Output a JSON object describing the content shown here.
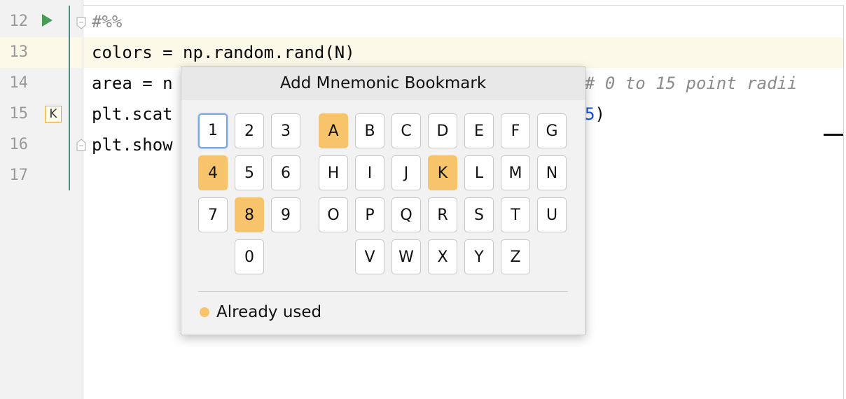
{
  "editor": {
    "lines": [
      {
        "no": "12"
      },
      {
        "no": "13"
      },
      {
        "no": "14"
      },
      {
        "no": "15"
      },
      {
        "no": "16"
      },
      {
        "no": "17"
      }
    ],
    "code": {
      "l12": "#%%",
      "l13": "colors = np.random.rand(N)",
      "l14_pre": "area = n",
      "l14_comment": "# 0 to 15 point radii",
      "l15_pre": "plt.scat",
      "l15_num": "5",
      "l15_post": ")",
      "l16": "plt.show"
    },
    "bookmark_gutter_label": "K",
    "icons": {
      "run": "run-cell-icon",
      "fold_start": "fold-start-icon",
      "fold_end": "fold-end-icon"
    }
  },
  "popup": {
    "title": "Add Mnemonic Bookmark",
    "keys": {
      "k1": "1",
      "k2": "2",
      "k3": "3",
      "k4": "4",
      "k5": "5",
      "k6": "6",
      "k7": "7",
      "k8": "8",
      "k9": "9",
      "k0": "0",
      "A": "A",
      "B": "B",
      "C": "C",
      "D": "D",
      "E": "E",
      "F": "F",
      "G": "G",
      "H": "H",
      "I": "I",
      "J": "J",
      "K": "K",
      "L": "L",
      "M": "M",
      "N": "N",
      "O": "O",
      "P": "P",
      "Q": "Q",
      "R": "R",
      "S": "S",
      "T": "T",
      "U": "U",
      "V": "V",
      "W": "W",
      "X": "X",
      "Y": "Y",
      "Z": "Z"
    },
    "used_keys": [
      "A",
      "4",
      "K",
      "8"
    ],
    "selected_key": "1",
    "legend": "Already used",
    "colors": {
      "used": "#f7c46c",
      "selected_border": "#7aa7e6"
    }
  }
}
